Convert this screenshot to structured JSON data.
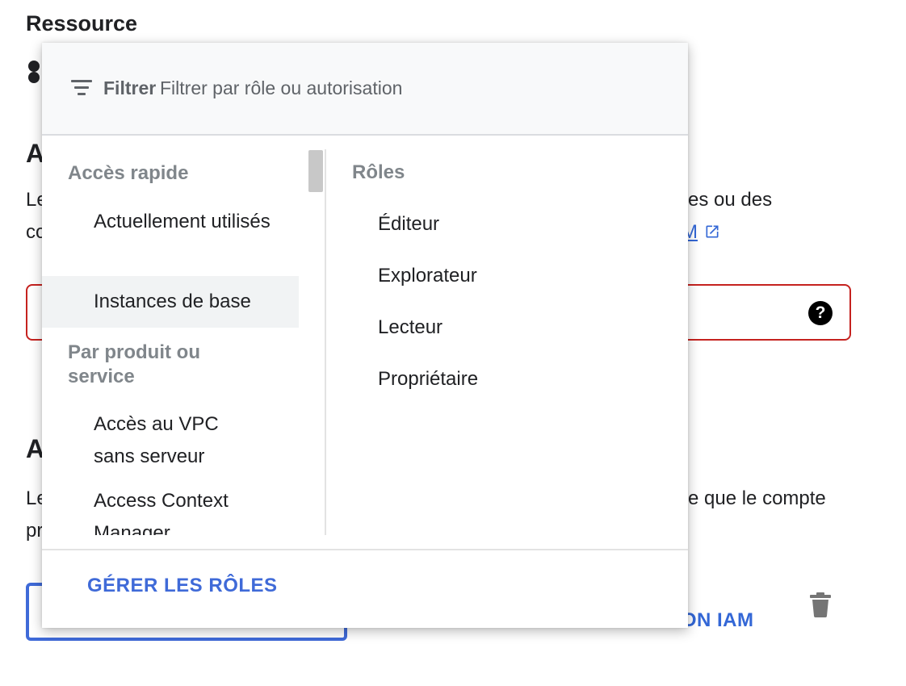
{
  "page": {
    "resource_heading": "Ressource",
    "section_a_initial": "A",
    "section_b_initial": "A",
    "text_left_1": "Le",
    "text_left_2": "co",
    "text_left_3": "Le",
    "text_left_4": "pr",
    "text_right_1": "es ou des",
    "text_right_link": "M",
    "text_right_2": "e que le compte",
    "help_symbol": "?",
    "add_condition_label": "AJOUTER UNE CONDITION IAM",
    "accent_color": "#3367d6",
    "error_color": "#c5221f"
  },
  "popup": {
    "filter": {
      "label": "Filtrer",
      "placeholder": "Filtrer par rôle ou autorisation"
    },
    "left": {
      "quick_access_title": "Accès rapide",
      "quick_items": [
        {
          "label": "Actuellement utilisés"
        },
        {
          "label": "Instances de base",
          "selected": true
        }
      ],
      "by_product_title": "Par produit ou service",
      "product_items": [
        {
          "label": "Accès au VPC sans serveur"
        },
        {
          "label": "Access Context Manager"
        }
      ]
    },
    "right": {
      "roles_title": "Rôles",
      "roles": [
        {
          "label": "Éditeur"
        },
        {
          "label": "Explorateur"
        },
        {
          "label": "Lecteur"
        },
        {
          "label": "Propriétaire"
        }
      ]
    },
    "footer": {
      "manage_roles_label": "GÉRER LES RÔLES"
    },
    "icons": {
      "filter": "filter-list-icon",
      "delete": "trash-icon",
      "help": "help-icon",
      "external": "open-in-new-icon"
    }
  }
}
